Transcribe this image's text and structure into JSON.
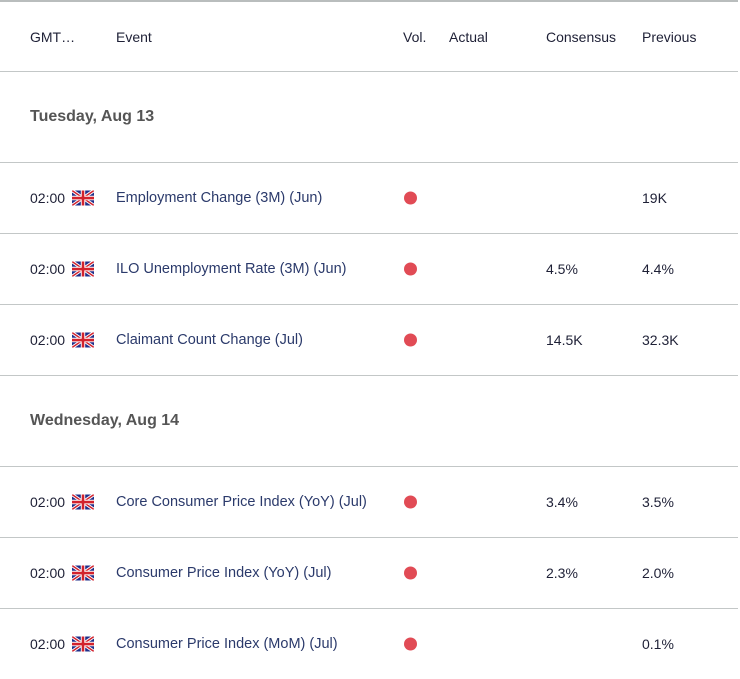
{
  "header": {
    "time": "GMT…",
    "event": "Event",
    "vol": "Vol.",
    "actual": "Actual",
    "consensus": "Consensus",
    "previous": "Previous"
  },
  "colors": {
    "volatility_high": "#e14b55",
    "event_text": "#2b3a6b",
    "date_text": "#555555"
  },
  "days": [
    {
      "date": "Tuesday, Aug 13",
      "events": [
        {
          "time": "02:00",
          "country": "uk-flag",
          "name": "Employment Change (3M) (Jun)",
          "volatility": "high",
          "actual": "",
          "consensus": "",
          "previous": "19K"
        },
        {
          "time": "02:00",
          "country": "uk-flag",
          "name": "ILO Unemployment Rate (3M) (Jun)",
          "volatility": "high",
          "actual": "",
          "consensus": "4.5%",
          "previous": "4.4%"
        },
        {
          "time": "02:00",
          "country": "uk-flag",
          "name": "Claimant Count Change (Jul)",
          "volatility": "high",
          "actual": "",
          "consensus": "14.5K",
          "previous": "32.3K"
        }
      ]
    },
    {
      "date": "Wednesday, Aug 14",
      "events": [
        {
          "time": "02:00",
          "country": "uk-flag",
          "name": "Core Consumer Price Index (YoY) (Jul)",
          "volatility": "high",
          "actual": "",
          "consensus": "3.4%",
          "previous": "3.5%"
        },
        {
          "time": "02:00",
          "country": "uk-flag",
          "name": "Consumer Price Index (YoY) (Jul)",
          "volatility": "high",
          "actual": "",
          "consensus": "2.3%",
          "previous": "2.0%"
        },
        {
          "time": "02:00",
          "country": "uk-flag",
          "name": "Consumer Price Index (MoM) (Jul)",
          "volatility": "high",
          "actual": "",
          "consensus": "",
          "previous": "0.1%"
        }
      ]
    }
  ]
}
